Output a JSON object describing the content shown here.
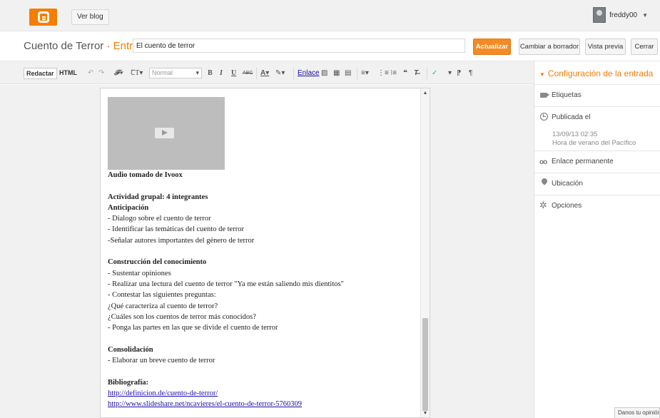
{
  "topbar": {
    "ver_blog": "Ver blog",
    "username": "freddy00"
  },
  "titlebar": {
    "blog_name": "Cuento de Terror",
    "separator": " · ",
    "section": "Entrada",
    "post_title": "El cuento de terror",
    "actualizar": "Actualizar",
    "cambiar_borrador": "Cambiar a borrador",
    "vista_previa": "Vista previa",
    "cerrar": "Cerrar"
  },
  "toolbar": {
    "redactar": "Redactar",
    "html": "HTML",
    "format_value": "Normal",
    "enlace": "Enlace"
  },
  "editor": {
    "lines": [
      {
        "text": "Audio tomado de Ivoox",
        "bold": true
      },
      {
        "text": "",
        "gap": true
      },
      {
        "text": "Actividad grupal: 4 integrantes",
        "bold": true
      },
      {
        "text": "Anticipación",
        "bold": true
      },
      {
        "text": "- Dialogo sobre el cuento de terror"
      },
      {
        "text": "- Identificar las temáticas del cuento de terror"
      },
      {
        "text": "-Señalar autores importantes del género de terror"
      },
      {
        "text": "",
        "gap": true
      },
      {
        "text": "Construcción del conocimiento",
        "bold": true
      },
      {
        "text": "- Sustentar opiniones"
      },
      {
        "text": "- Realizar una lectura del cuento de terror \"Ya me están saliendo mis dientitos\""
      },
      {
        "text": "- Contestar las siguientes preguntas:"
      },
      {
        "text": "¿Qué caracteriza al cuento de terror?"
      },
      {
        "text": "¿Cuáles son los cuentos de terror más conocidos?"
      },
      {
        "text": "- Ponga las partes en las que se divide el cuento de terror"
      },
      {
        "text": "",
        "gap": true
      },
      {
        "text": "Consolidación",
        "bold": true
      },
      {
        "text": "- Elaborar un breve cuento de terror"
      },
      {
        "text": "",
        "gap": true
      },
      {
        "text": "Bibliografía:",
        "bold": true
      },
      {
        "text": "http://definicion.de/cuento-de-terror/",
        "link": true
      },
      {
        "text": "http://www.slideshare.net/ncavieres/el-cuento-de-terror-5760309",
        "link": true
      }
    ]
  },
  "sidebar": {
    "title": "Configuración de la entrada",
    "etiquetas": "Etiquetas",
    "publicada": "Publicada el",
    "fecha": "13/09/13 02:35",
    "zona": "Hora de verano del Pacífico",
    "enlace_permanente": "Enlace permanente",
    "ubicacion": "Ubicación",
    "opciones": "Opciones"
  },
  "feedback": "Danos tu opinión"
}
